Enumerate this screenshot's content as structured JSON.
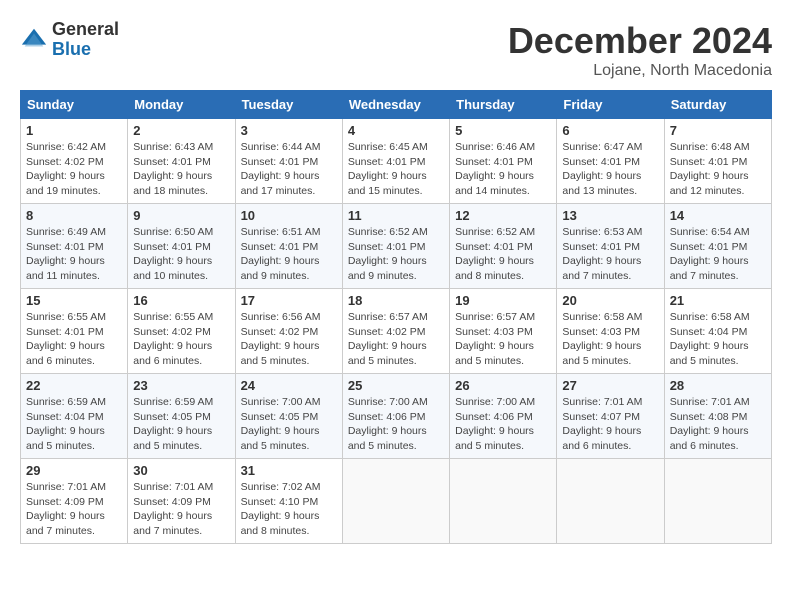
{
  "header": {
    "logo": {
      "general": "General",
      "blue": "Blue"
    },
    "title": "December 2024",
    "location": "Lojane, North Macedonia"
  },
  "weekdays": [
    "Sunday",
    "Monday",
    "Tuesday",
    "Wednesday",
    "Thursday",
    "Friday",
    "Saturday"
  ],
  "weeks": [
    [
      {
        "day": "1",
        "info": "Sunrise: 6:42 AM\nSunset: 4:02 PM\nDaylight: 9 hours\nand 19 minutes."
      },
      {
        "day": "2",
        "info": "Sunrise: 6:43 AM\nSunset: 4:01 PM\nDaylight: 9 hours\nand 18 minutes."
      },
      {
        "day": "3",
        "info": "Sunrise: 6:44 AM\nSunset: 4:01 PM\nDaylight: 9 hours\nand 17 minutes."
      },
      {
        "day": "4",
        "info": "Sunrise: 6:45 AM\nSunset: 4:01 PM\nDaylight: 9 hours\nand 15 minutes."
      },
      {
        "day": "5",
        "info": "Sunrise: 6:46 AM\nSunset: 4:01 PM\nDaylight: 9 hours\nand 14 minutes."
      },
      {
        "day": "6",
        "info": "Sunrise: 6:47 AM\nSunset: 4:01 PM\nDaylight: 9 hours\nand 13 minutes."
      },
      {
        "day": "7",
        "info": "Sunrise: 6:48 AM\nSunset: 4:01 PM\nDaylight: 9 hours\nand 12 minutes."
      }
    ],
    [
      {
        "day": "8",
        "info": "Sunrise: 6:49 AM\nSunset: 4:01 PM\nDaylight: 9 hours\nand 11 minutes."
      },
      {
        "day": "9",
        "info": "Sunrise: 6:50 AM\nSunset: 4:01 PM\nDaylight: 9 hours\nand 10 minutes."
      },
      {
        "day": "10",
        "info": "Sunrise: 6:51 AM\nSunset: 4:01 PM\nDaylight: 9 hours\nand 9 minutes."
      },
      {
        "day": "11",
        "info": "Sunrise: 6:52 AM\nSunset: 4:01 PM\nDaylight: 9 hours\nand 9 minutes."
      },
      {
        "day": "12",
        "info": "Sunrise: 6:52 AM\nSunset: 4:01 PM\nDaylight: 9 hours\nand 8 minutes."
      },
      {
        "day": "13",
        "info": "Sunrise: 6:53 AM\nSunset: 4:01 PM\nDaylight: 9 hours\nand 7 minutes."
      },
      {
        "day": "14",
        "info": "Sunrise: 6:54 AM\nSunset: 4:01 PM\nDaylight: 9 hours\nand 7 minutes."
      }
    ],
    [
      {
        "day": "15",
        "info": "Sunrise: 6:55 AM\nSunset: 4:01 PM\nDaylight: 9 hours\nand 6 minutes."
      },
      {
        "day": "16",
        "info": "Sunrise: 6:55 AM\nSunset: 4:02 PM\nDaylight: 9 hours\nand 6 minutes."
      },
      {
        "day": "17",
        "info": "Sunrise: 6:56 AM\nSunset: 4:02 PM\nDaylight: 9 hours\nand 5 minutes."
      },
      {
        "day": "18",
        "info": "Sunrise: 6:57 AM\nSunset: 4:02 PM\nDaylight: 9 hours\nand 5 minutes."
      },
      {
        "day": "19",
        "info": "Sunrise: 6:57 AM\nSunset: 4:03 PM\nDaylight: 9 hours\nand 5 minutes."
      },
      {
        "day": "20",
        "info": "Sunrise: 6:58 AM\nSunset: 4:03 PM\nDaylight: 9 hours\nand 5 minutes."
      },
      {
        "day": "21",
        "info": "Sunrise: 6:58 AM\nSunset: 4:04 PM\nDaylight: 9 hours\nand 5 minutes."
      }
    ],
    [
      {
        "day": "22",
        "info": "Sunrise: 6:59 AM\nSunset: 4:04 PM\nDaylight: 9 hours\nand 5 minutes."
      },
      {
        "day": "23",
        "info": "Sunrise: 6:59 AM\nSunset: 4:05 PM\nDaylight: 9 hours\nand 5 minutes."
      },
      {
        "day": "24",
        "info": "Sunrise: 7:00 AM\nSunset: 4:05 PM\nDaylight: 9 hours\nand 5 minutes."
      },
      {
        "day": "25",
        "info": "Sunrise: 7:00 AM\nSunset: 4:06 PM\nDaylight: 9 hours\nand 5 minutes."
      },
      {
        "day": "26",
        "info": "Sunrise: 7:00 AM\nSunset: 4:06 PM\nDaylight: 9 hours\nand 5 minutes."
      },
      {
        "day": "27",
        "info": "Sunrise: 7:01 AM\nSunset: 4:07 PM\nDaylight: 9 hours\nand 6 minutes."
      },
      {
        "day": "28",
        "info": "Sunrise: 7:01 AM\nSunset: 4:08 PM\nDaylight: 9 hours\nand 6 minutes."
      }
    ],
    [
      {
        "day": "29",
        "info": "Sunrise: 7:01 AM\nSunset: 4:09 PM\nDaylight: 9 hours\nand 7 minutes."
      },
      {
        "day": "30",
        "info": "Sunrise: 7:01 AM\nSunset: 4:09 PM\nDaylight: 9 hours\nand 7 minutes."
      },
      {
        "day": "31",
        "info": "Sunrise: 7:02 AM\nSunset: 4:10 PM\nDaylight: 9 hours\nand 8 minutes."
      },
      null,
      null,
      null,
      null
    ]
  ]
}
